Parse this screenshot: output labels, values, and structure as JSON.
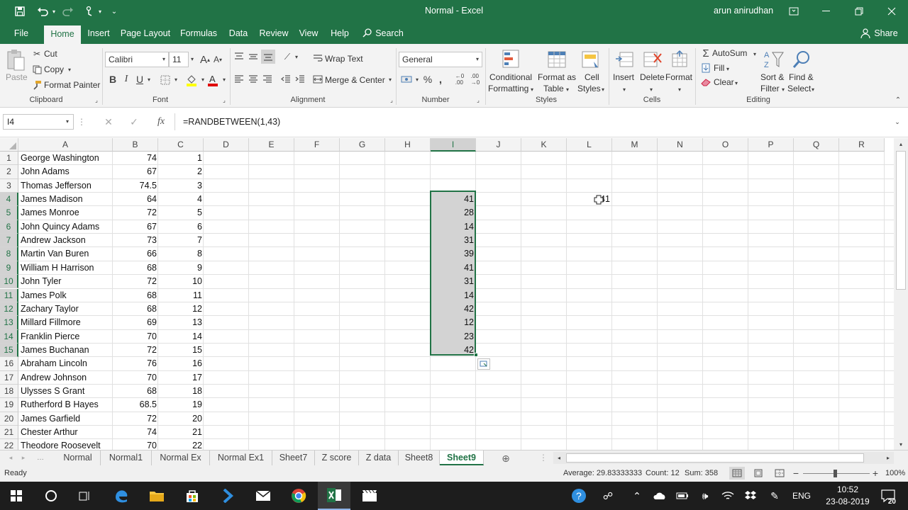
{
  "window": {
    "title": "Normal  -  Excel",
    "user": "arun anirudhan"
  },
  "menu": {
    "tabs": [
      "File",
      "Home",
      "Insert",
      "Page Layout",
      "Formulas",
      "Data",
      "Review",
      "View",
      "Help"
    ],
    "active_tab": "Home",
    "search_label": "Search",
    "share_label": "Share"
  },
  "ribbon": {
    "clipboard": {
      "paste": "Paste",
      "cut": "Cut",
      "copy": "Copy",
      "format_painter": "Format Painter",
      "label": "Clipboard"
    },
    "font": {
      "name": "Calibri",
      "size": "11",
      "label": "Font",
      "bold": "B",
      "italic": "I",
      "underline": "U"
    },
    "alignment": {
      "wrap_text": "Wrap Text",
      "merge_center": "Merge & Center",
      "label": "Alignment"
    },
    "number": {
      "format": "General",
      "label": "Number"
    },
    "styles": {
      "conditional_1": "Conditional",
      "conditional_2": "Formatting",
      "format_table_1": "Format as",
      "format_table_2": "Table",
      "cell_styles_1": "Cell",
      "cell_styles_2": "Styles",
      "label": "Styles"
    },
    "cells": {
      "insert": "Insert",
      "delete": "Delete",
      "format": "Format",
      "label": "Cells"
    },
    "editing": {
      "autosum": "AutoSum",
      "fill": "Fill",
      "clear": "Clear",
      "sort_1": "Sort &",
      "sort_2": "Filter",
      "find_1": "Find &",
      "find_2": "Select",
      "label": "Editing"
    }
  },
  "formula_bar": {
    "name_box": "I4",
    "fx": "fx",
    "formula": "=RANDBETWEEN(1,43)"
  },
  "columns": [
    "A",
    "B",
    "C",
    "D",
    "E",
    "F",
    "G",
    "H",
    "I",
    "J",
    "K",
    "L",
    "M",
    "N",
    "O",
    "P",
    "Q",
    "R"
  ],
  "selected_column": "I",
  "rows": [
    {
      "n": "1",
      "a": "George Washington",
      "b": "74",
      "c": "1",
      "i": ""
    },
    {
      "n": "2",
      "a": "John Adams",
      "b": "67",
      "c": "2",
      "i": ""
    },
    {
      "n": "3",
      "a": "Thomas Jefferson",
      "b": "74.5",
      "c": "3",
      "i": ""
    },
    {
      "n": "4",
      "a": "James Madison",
      "b": "64",
      "c": "4",
      "i": "41"
    },
    {
      "n": "5",
      "a": "James Monroe",
      "b": "72",
      "c": "5",
      "i": "28"
    },
    {
      "n": "6",
      "a": "John Quincy Adams",
      "b": "67",
      "c": "6",
      "i": "14"
    },
    {
      "n": "7",
      "a": "Andrew Jackson",
      "b": "73",
      "c": "7",
      "i": "31"
    },
    {
      "n": "8",
      "a": "Martin Van Buren",
      "b": "66",
      "c": "8",
      "i": "39"
    },
    {
      "n": "9",
      "a": "William H Harrison",
      "b": "68",
      "c": "9",
      "i": "41"
    },
    {
      "n": "10",
      "a": "John Tyler",
      "b": "72",
      "c": "10",
      "i": "31"
    },
    {
      "n": "11",
      "a": "James Polk",
      "b": "68",
      "c": "11",
      "i": "14"
    },
    {
      "n": "12",
      "a": "Zachary Taylor",
      "b": "68",
      "c": "12",
      "i": "42"
    },
    {
      "n": "13",
      "a": "Millard Fillmore",
      "b": "69",
      "c": "13",
      "i": "12"
    },
    {
      "n": "14",
      "a": "Franklin Pierce",
      "b": "70",
      "c": "14",
      "i": "23"
    },
    {
      "n": "15",
      "a": "James Buchanan",
      "b": "72",
      "c": "15",
      "i": "42"
    },
    {
      "n": "16",
      "a": "Abraham Lincoln",
      "b": "76",
      "c": "16",
      "i": ""
    },
    {
      "n": "17",
      "a": "Andrew Johnson",
      "b": "70",
      "c": "17",
      "i": ""
    },
    {
      "n": "18",
      "a": "Ulysses S Grant",
      "b": "68",
      "c": "18",
      "i": ""
    },
    {
      "n": "19",
      "a": "Rutherford B Hayes",
      "b": "68.5",
      "c": "19",
      "i": ""
    },
    {
      "n": "20",
      "a": "James Garfield",
      "b": "72",
      "c": "20",
      "i": ""
    },
    {
      "n": "21",
      "a": "Chester Arthur",
      "b": "74",
      "c": "21",
      "i": ""
    },
    {
      "n": "22",
      "a": "Theodore Roosevelt",
      "b": "70",
      "c": "22",
      "i": ""
    }
  ],
  "l4_value": "41",
  "sheets": [
    "Normal",
    "Normal1",
    "Normal Ex",
    "Normal Ex1",
    "Sheet7",
    "Z score",
    "Z data",
    "Sheet8",
    "Sheet9"
  ],
  "active_sheet": "Sheet9",
  "status": {
    "ready": "Ready",
    "average": "Average: 29.83333333",
    "count": "Count: 12",
    "sum": "Sum: 358",
    "zoom": "100%"
  },
  "taskbar": {
    "lang": "ENG",
    "time": "10:52",
    "date": "23-08-2019",
    "notifications": "20"
  },
  "colors": {
    "accent": "#217346",
    "selection": "#d3d3d3"
  }
}
